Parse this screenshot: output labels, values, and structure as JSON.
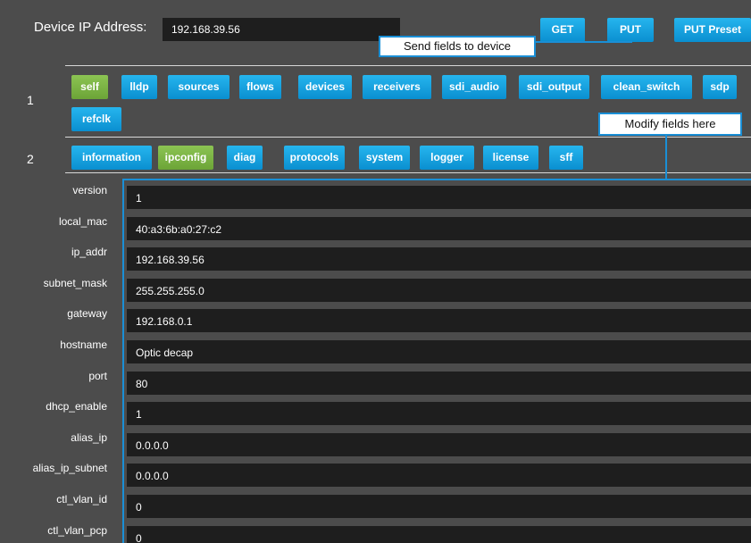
{
  "header": {
    "ip_label": "Device IP Address:",
    "ip_value": "192.168.39.56",
    "get_label": "GET",
    "put_label": "PUT",
    "put_preset_label": "PUT Preset"
  },
  "callouts": {
    "send": "Send fields to device",
    "modify": "Modify fields here"
  },
  "row1": {
    "number": "1",
    "tabs": [
      "self",
      "lldp",
      "sources",
      "flows",
      "devices",
      "receivers",
      "sdi_audio",
      "sdi_output",
      "clean_switch",
      "sdp",
      "refclk"
    ],
    "active": "self"
  },
  "row2": {
    "number": "2",
    "tabs": [
      "information",
      "ipconfig",
      "diag",
      "protocols",
      "system",
      "logger",
      "license",
      "sff"
    ],
    "active": "ipconfig"
  },
  "fields": [
    {
      "label": "version",
      "value": "1"
    },
    {
      "label": "local_mac",
      "value": "40:a3:6b:a0:27:c2"
    },
    {
      "label": "ip_addr",
      "value": "192.168.39.56"
    },
    {
      "label": "subnet_mask",
      "value": "255.255.255.0"
    },
    {
      "label": "gateway",
      "value": "192.168.0.1"
    },
    {
      "label": "hostname",
      "value": "Optic decap"
    },
    {
      "label": "port",
      "value": "80"
    },
    {
      "label": "dhcp_enable",
      "value": "1"
    },
    {
      "label": "alias_ip",
      "value": "0.0.0.0"
    },
    {
      "label": "alias_ip_subnet",
      "value": "0.0.0.0"
    },
    {
      "label": "ctl_vlan_id",
      "value": "0"
    },
    {
      "label": "ctl_vlan_pcp",
      "value": "0"
    }
  ],
  "colors": {
    "panel": "#4c4c4c",
    "button_blue": "#1aa3e0",
    "button_active": "#7ab646",
    "field_bg": "#1e1e1e",
    "callout_border": "#1a8fd6"
  }
}
